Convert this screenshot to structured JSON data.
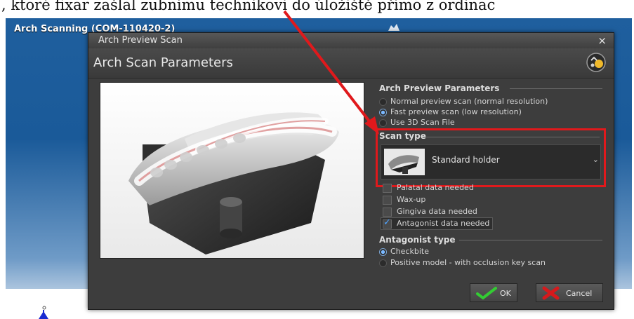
{
  "caption": {
    "text": ", ktoré fixar zašlal zubnímu technikovi do úložiště přímo z ordinac"
  },
  "desktop": {
    "window_title": "Arch Scanning (COM-110420-2)"
  },
  "dialog": {
    "title": "Arch Preview Scan",
    "close_label": "×",
    "heading": "Arch Scan Parameters",
    "preview_params": {
      "title": "Arch Preview Parameters",
      "options": [
        {
          "label": "Normal preview scan (normal resolution)",
          "selected": false
        },
        {
          "label": "Fast preview scan (low resolution)",
          "selected": true
        },
        {
          "label": "Use 3D Scan File",
          "selected": false
        }
      ]
    },
    "scan_type": {
      "title": "Scan type",
      "selected_value": "Standard holder",
      "chevron": "⌄"
    },
    "checkboxes": [
      {
        "label": "Palatal data needed",
        "checked": false
      },
      {
        "label": "Wax-up",
        "checked": false
      },
      {
        "label": "Gingiva data needed",
        "checked": false
      },
      {
        "label": "Antagonist data needed",
        "checked": true
      }
    ],
    "antagonist_type": {
      "title": "Antagonist type",
      "options": [
        {
          "label": "Checkbite",
          "selected": true
        },
        {
          "label": "Positive model - with occlusion key scan",
          "selected": false
        }
      ]
    },
    "buttons": {
      "ok_label": "OK",
      "cancel_label": "Cancel"
    }
  },
  "colors": {
    "highlight_red": "#e0191c",
    "desktop_blue": "#1f5f9e",
    "dialog_bg": "#3d3d3d",
    "ok_green": "#33cc33",
    "cancel_red": "#d6191c"
  },
  "icons": [
    "help-wizard-icon",
    "close-icon",
    "checkmark-icon",
    "cancel-x-icon",
    "chevron-down-icon",
    "annotation-arrow"
  ]
}
